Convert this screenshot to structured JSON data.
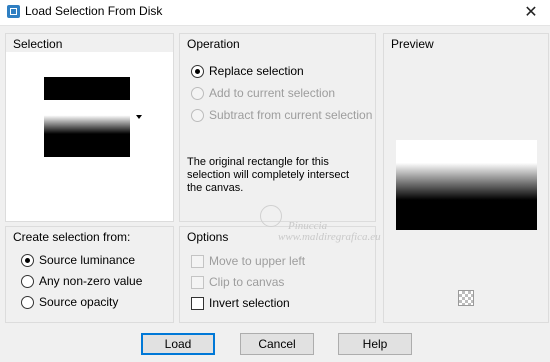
{
  "window": {
    "title": "Load Selection From Disk",
    "close_glyph": "✕",
    "icon": "selection-app-icon"
  },
  "selection_panel": {
    "header": "Selection",
    "dropdown_icon": "chevron-down-icon"
  },
  "operation_panel": {
    "header": "Operation",
    "options": [
      {
        "label": "Replace selection",
        "checked": true,
        "enabled": true
      },
      {
        "label": "Add to current selection",
        "checked": false,
        "enabled": false
      },
      {
        "label": "Subtract from current selection",
        "checked": false,
        "enabled": false
      }
    ],
    "info_text": "The original rectangle for this selection will completely intersect the canvas."
  },
  "preview_panel": {
    "header": "Preview",
    "checker_icon": "transparency-checker-icon"
  },
  "create_from_panel": {
    "header": "Create selection from:",
    "options": [
      {
        "label": "Source luminance",
        "checked": true
      },
      {
        "label": "Any non-zero value",
        "checked": false
      },
      {
        "label": "Source opacity",
        "checked": false
      }
    ]
  },
  "options_panel": {
    "header": "Options",
    "options": [
      {
        "label": "Move to upper left",
        "checked": false,
        "enabled": false
      },
      {
        "label": "Clip to canvas",
        "checked": false,
        "enabled": false
      },
      {
        "label": "Invert selection",
        "checked": false,
        "enabled": true
      }
    ]
  },
  "buttons": {
    "load": "Load",
    "cancel": "Cancel",
    "help": "Help"
  },
  "watermark": {
    "line1": "Pinuccia",
    "line2": "www.maldiregrafica.eu"
  },
  "colors": {
    "accent": "#0078d7",
    "panel_border": "#dcdcdc",
    "background": "#f0f0f0"
  }
}
